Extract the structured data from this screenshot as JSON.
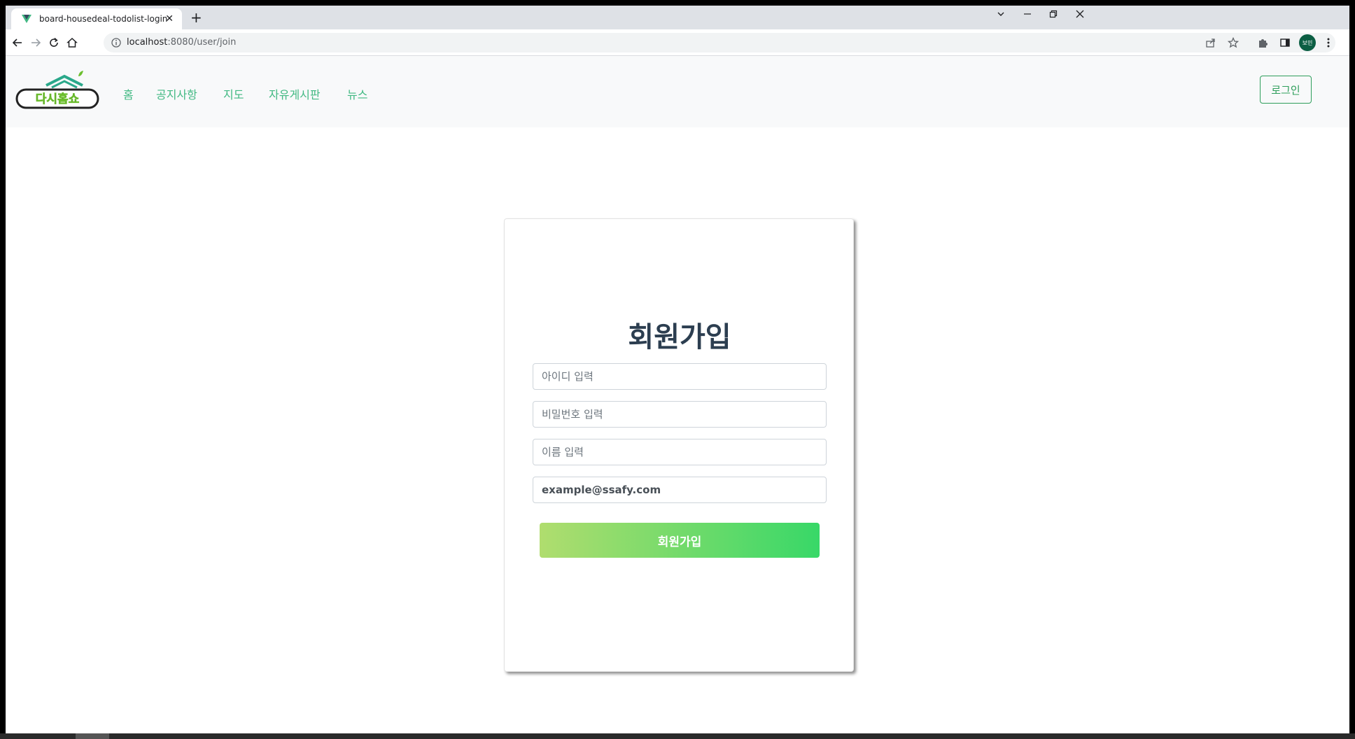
{
  "browser": {
    "tab_title": "board-housedeal-todolist-login",
    "url_host": "localhost",
    "url_path": ":8080/user/join",
    "profile_initials": "보민"
  },
  "navbar": {
    "logo_text": "다시홈쇼",
    "links": [
      {
        "label": "홈"
      },
      {
        "label": "공지사항"
      },
      {
        "label": "지도"
      },
      {
        "label": "자유게시판"
      },
      {
        "label": "뉴스"
      }
    ],
    "login_label": "로그인"
  },
  "join_form": {
    "title": "회원가입",
    "id_placeholder": "아이디 입력",
    "password_placeholder": "비밀번호 입력",
    "name_placeholder": "이름 입력",
    "email_value": "example@ssafy.com",
    "submit_label": "회원가입"
  },
  "colors": {
    "accent": "#42b983",
    "button_gradient_start": "#b0dd6e",
    "button_gradient_end": "#38d868"
  }
}
